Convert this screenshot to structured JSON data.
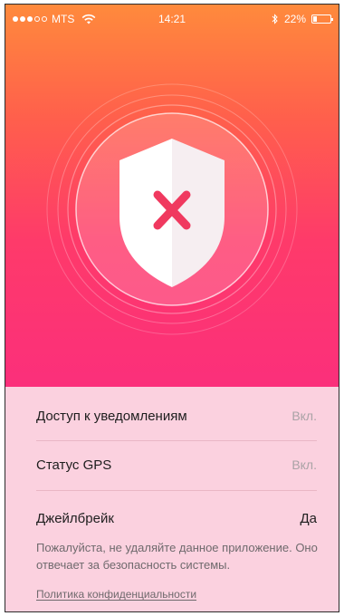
{
  "status_bar": {
    "carrier": "MTS",
    "time": "14:21",
    "battery": "22%",
    "battery_level": 0.22,
    "signal_bars_filled": 3,
    "signal_bars_total": 5
  },
  "hero": {
    "shield_icon": "shield-x-icon",
    "status": "error"
  },
  "checks": [
    {
      "label": "Доступ к уведомлениям",
      "value": "Вкл."
    },
    {
      "label": "Статус GPS",
      "value": "Вкл."
    },
    {
      "label": "Джейлбрейк",
      "value": "Да"
    }
  ],
  "notice": "Пожалуйста, не удаляйте данное приложение. Оно отвечает за безопасность системы.",
  "privacy_link": "Политика конфиденциальности",
  "colors": {
    "gradient_top": "#ff8a3c",
    "gradient_bottom": "#fb2f7b",
    "x_mark": "#f0395f",
    "panel": "#fbd1df"
  }
}
